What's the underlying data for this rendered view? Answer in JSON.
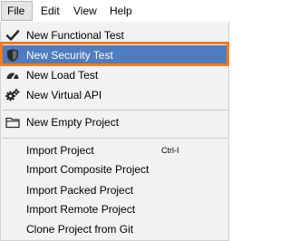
{
  "menubar": {
    "file": "File",
    "edit": "Edit",
    "view": "View",
    "help": "Help"
  },
  "file_menu": {
    "new_functional_test": {
      "label": "New Functional Test",
      "icon": "checkmark-icon"
    },
    "new_security_test": {
      "label": "New Security Test",
      "icon": "shield-icon"
    },
    "new_load_test": {
      "label": "New Load Test",
      "icon": "speedometer-icon"
    },
    "new_virtual_api": {
      "label": "New Virtual API",
      "icon": "gears-icon"
    },
    "new_empty_project": {
      "label": "New Empty Project",
      "icon": "folder-icon"
    },
    "import_project": {
      "label": "Import Project",
      "shortcut": "Ctrl-I"
    },
    "import_composite_project": {
      "label": "Import Composite Project"
    },
    "import_packed_project": {
      "label": "Import Packed Project"
    },
    "import_remote_project": {
      "label": "Import Remote Project"
    },
    "clone_project_from_git": {
      "label": "Clone Project from Git"
    }
  },
  "colors": {
    "selection": "#4f7bbf",
    "highlight_border": "#f07d1e"
  }
}
